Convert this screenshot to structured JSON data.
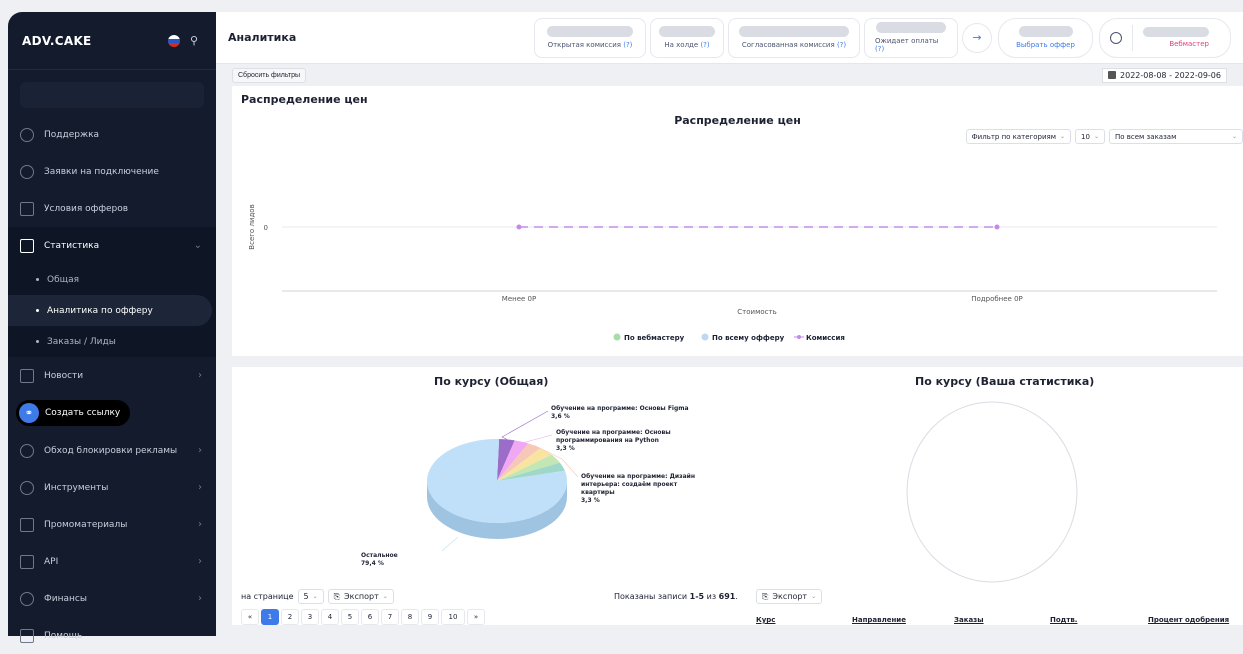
{
  "sidebar": {
    "logo": "ADV.CAKE",
    "items": [
      {
        "label": "Поддержка",
        "icon": "question-circle-icon"
      },
      {
        "label": "Заявки на подключение",
        "icon": "users-icon"
      },
      {
        "label": "Условия офферов",
        "icon": "document-icon"
      },
      {
        "label": "Статистика",
        "icon": "monitor-icon"
      },
      {
        "label": "Новости",
        "icon": "news-icon"
      },
      {
        "label": "Обход блокировки рекламы",
        "icon": "adblock-icon"
      },
      {
        "label": "Инструменты",
        "icon": "tools-icon"
      },
      {
        "label": "Промоматериалы",
        "icon": "gift-icon"
      },
      {
        "label": "API",
        "icon": "api-icon"
      },
      {
        "label": "Финансы",
        "icon": "coin-icon"
      },
      {
        "label": "Помощь",
        "icon": "help-icon"
      }
    ],
    "stats_sub": [
      "Общая",
      "Аналитика по офферу",
      "Заказы / Лиды"
    ],
    "create_link": "Создать ссылку"
  },
  "header": {
    "title": "Аналитика",
    "stats": [
      {
        "label": "Открытая комиссия",
        "hint": "(?)"
      },
      {
        "label": "На холде",
        "hint": "(?)"
      },
      {
        "label": "Согласованная комиссия",
        "hint": "(?)"
      },
      {
        "label": "Ожидает оплаты",
        "hint": "(?)"
      }
    ],
    "offer_button": "Выбрать оффер",
    "user_role": "Вебмастер"
  },
  "filters": {
    "reset": "Сбросить фильтры",
    "date_range": "2022-08-08 - 2022-09-06"
  },
  "price_card": {
    "title": "Распределение цен",
    "chart_title": "Распределение цен",
    "category_filter": "Фильтр по категориям",
    "count": "10",
    "orders_filter": "По всем заказам"
  },
  "pie_card": {
    "left_title": "По курсу (Общая)",
    "right_title": "По курсу (Ваша статистика)",
    "per_page_label": "на странице",
    "per_page": "5",
    "export": "Экспорт",
    "shown_prefix": "Показаны записи ",
    "shown_range": "1-5",
    "shown_mid": " из ",
    "shown_total": "691",
    "pages": [
      "«",
      "1",
      "2",
      "3",
      "4",
      "5",
      "6",
      "7",
      "8",
      "9",
      "10",
      "»"
    ],
    "columns": [
      "Курс",
      "Направление",
      "Заказы",
      "Подтв.",
      "Процент одобрения"
    ]
  },
  "chart_data": [
    {
      "type": "line",
      "title": "Распределение цен",
      "xlabel": "Стоимость",
      "ylabel": "Всего лидов",
      "categories": [
        "Менее 0Р",
        "Подробнее 0Р"
      ],
      "yticks": [
        "0"
      ],
      "series": [
        {
          "name": "По вебмастеру",
          "values": [
            0,
            0
          ],
          "color": "#a8dca8"
        },
        {
          "name": "По всему офферу",
          "values": [
            0,
            0
          ],
          "color": "#bcd8f5"
        },
        {
          "name": "Комиссия",
          "values": [
            0,
            0
          ],
          "color": "#c58ae8"
        }
      ]
    },
    {
      "type": "pie",
      "title": "По курсу (Общая)",
      "slices": [
        {
          "label": "Остальное",
          "value": 79.4,
          "display": "79,4 %",
          "color": "#bfe0f8"
        },
        {
          "label": "Обучение на программе: Основы Figma",
          "value": 3.6,
          "display": "3,6 %",
          "color": "#9b6cc8"
        },
        {
          "label": "Обучение на программе: Основы программирования на Python",
          "value": 3.3,
          "display": "3,3 %",
          "color": "#f1a8f4"
        },
        {
          "label": "Обучение на программе: Дизайн интерьера: создаём проект квартиры",
          "value": 3.3,
          "display": "3,3 %",
          "color": "#f6c8b8"
        },
        {
          "label": "",
          "value": 3.6,
          "display": "",
          "color": "#f8e4a0"
        },
        {
          "label": "",
          "value": 3.5,
          "display": "",
          "color": "#c2e6b4"
        },
        {
          "label": "",
          "value": 3.3,
          "display": "",
          "color": "#9fd8c8"
        }
      ]
    },
    {
      "type": "pie",
      "title": "По курсу (Ваша статистика)",
      "slices": []
    }
  ]
}
